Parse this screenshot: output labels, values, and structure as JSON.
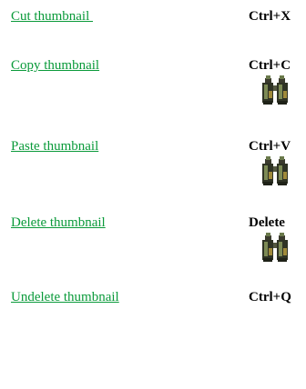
{
  "menu": {
    "items": [
      {
        "label": "Cut thumbnail ",
        "shortcut": "Ctrl+X"
      },
      {
        "label": "Copy thumbnail",
        "shortcut": "Ctrl+C"
      },
      {
        "label": "Paste thumbnail",
        "shortcut": "Ctrl+V"
      },
      {
        "label": "Delete thumbnail",
        "shortcut": "Delete"
      },
      {
        "label": "Undelete thumbnail",
        "shortcut": "Ctrl+Q"
      }
    ]
  },
  "icons": {
    "binoculars": "binoculars-icon"
  },
  "colors": {
    "link": "#0a9a3a",
    "shortcut": "#000000"
  }
}
